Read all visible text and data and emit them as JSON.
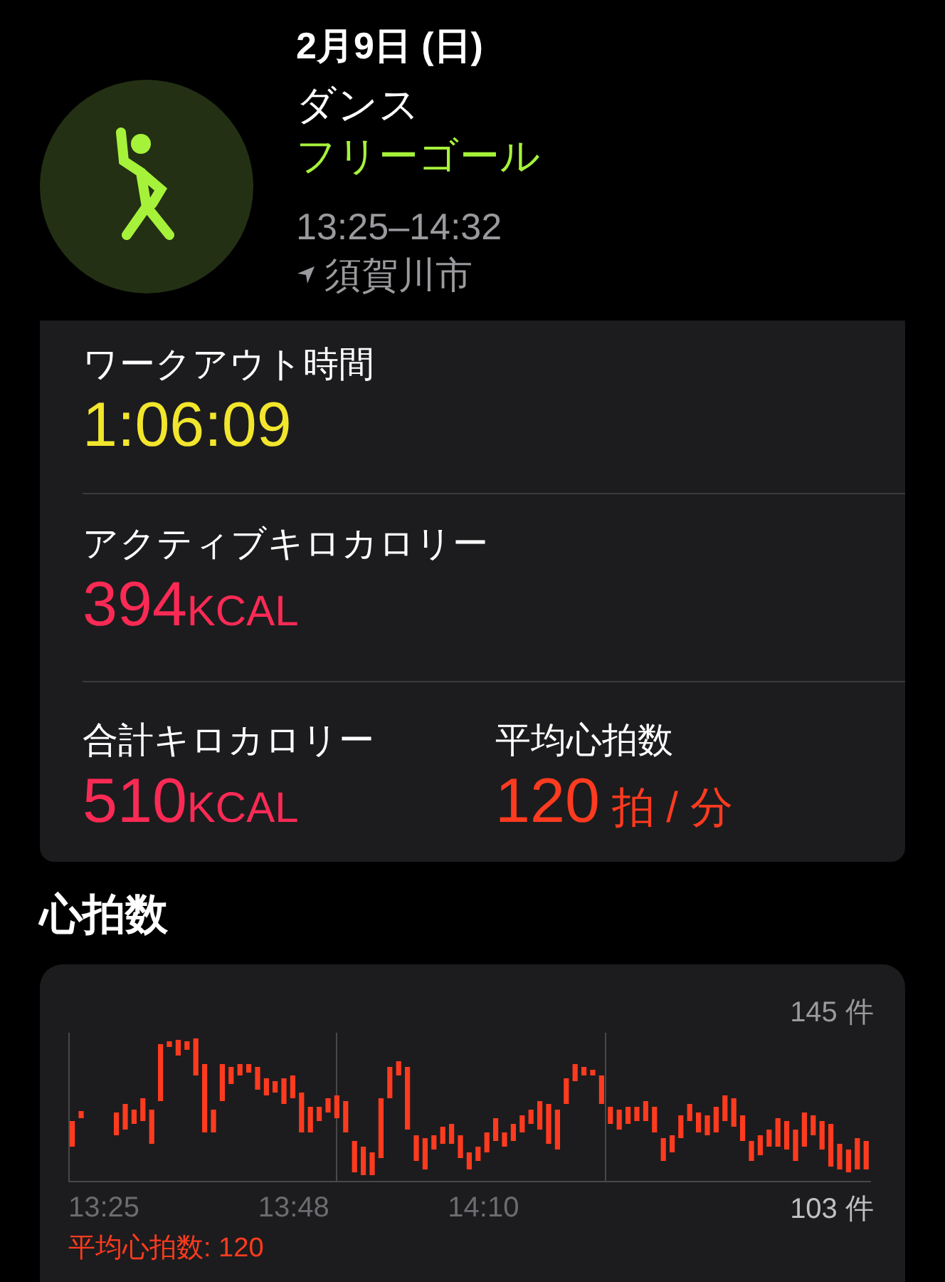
{
  "header": {
    "date": "2月9日 (日)",
    "activity": "ダンス",
    "goal": "フリーゴール",
    "time_range": "13:25–14:32",
    "location": "須賀川市"
  },
  "stats": [
    {
      "label": "ワークアウト時間",
      "number": "1:06:09",
      "color": "#f2e62d",
      "kind": "full"
    },
    {
      "label": "アクティブキロカロリー",
      "number": "394",
      "unit": "KCAL",
      "color": "#fa2a55",
      "kind": "full"
    },
    {
      "label": "合計キロカロリー",
      "number": "510",
      "unit": "KCAL",
      "color": "#fa2a55",
      "kind": "half"
    },
    {
      "label": "平均心拍数",
      "number": "120",
      "unit": "拍 / 分",
      "color": "#ff3b1f",
      "kind": "half"
    }
  ],
  "heart_rate": {
    "title": "心拍数",
    "max_label": "145 件",
    "min_label": "103 件",
    "times": [
      "13:25",
      "13:48",
      "14:10"
    ],
    "average": "平均心拍数: 120"
  }
}
